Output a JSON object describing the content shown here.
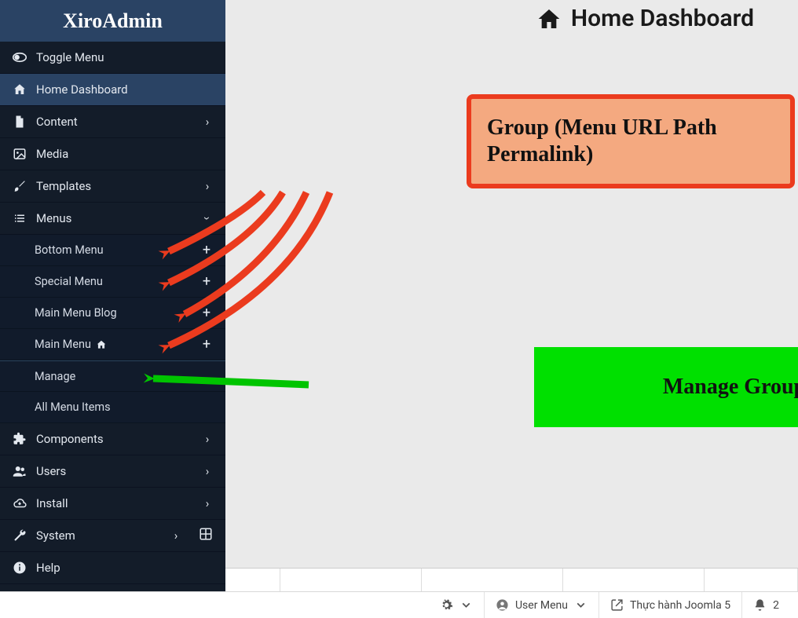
{
  "brand": "XiroAdmin",
  "page_title": "Home Dashboard",
  "sidebar": {
    "toggle": "Toggle Menu",
    "items": [
      {
        "label": "Home Dashboard",
        "active": true
      },
      {
        "label": "Content"
      },
      {
        "label": "Media"
      },
      {
        "label": "Templates"
      },
      {
        "label": "Menus",
        "expanded": true
      },
      {
        "label": "Components"
      },
      {
        "label": "Users"
      },
      {
        "label": "Install"
      },
      {
        "label": "System"
      },
      {
        "label": "Help"
      }
    ],
    "menus_sub": [
      {
        "label": "Bottom Menu",
        "plus": true
      },
      {
        "label": "Special Menu",
        "plus": true
      },
      {
        "label": "Main Menu Blog",
        "plus": true
      },
      {
        "label": "Main Menu",
        "plus": true,
        "home": true
      },
      {
        "label": "Manage"
      },
      {
        "label": "All Menu Items"
      }
    ]
  },
  "annotations": {
    "group_label": "Group (Menu URL Path Permalink)",
    "manage_label": "Manage Group",
    "colors": {
      "orange_border": "#eb3b1e",
      "orange_fill": "#f4a980",
      "green_fill": "#00e000"
    }
  },
  "statusbar": {
    "user_menu": "User Menu",
    "site_link": "Thực hành Joomla 5",
    "notifications": "2"
  }
}
